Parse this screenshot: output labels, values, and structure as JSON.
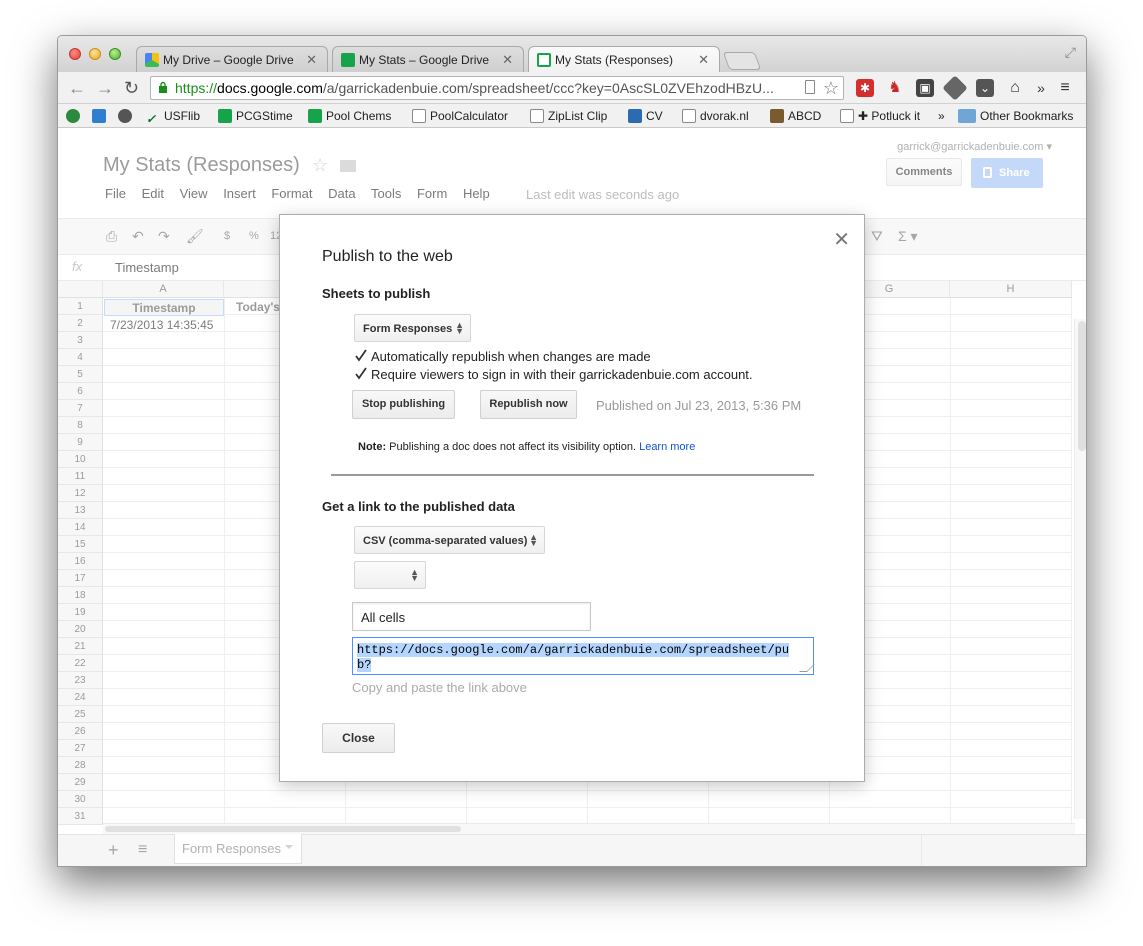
{
  "browser": {
    "tabs": [
      {
        "title": "My Drive – Google Drive"
      },
      {
        "title": "My Stats – Google Drive"
      },
      {
        "title": "My Stats (Responses)"
      }
    ],
    "url": {
      "scheme": "https://",
      "host": "docs.google.com",
      "path": "/a/garrickadenbuie.com/spreadsheet/ccc?key=0AscSL0ZVEhzodHBzU..."
    },
    "bookmarks": [
      {
        "label": "",
        "icon": "globe-icon",
        "color": "#2b8a3e"
      },
      {
        "label": "",
        "icon": "jstor-icon",
        "color": "#2f7fd1"
      },
      {
        "label": "",
        "icon": "badge-280-icon",
        "color": "#555555"
      },
      {
        "label": "USFlib",
        "icon": "usf-icon",
        "color": "#0a6b2b"
      },
      {
        "label": "PCGStime",
        "icon": "sheet-icon",
        "color": "#16a34a"
      },
      {
        "label": "Pool Chems",
        "icon": "sheet-icon",
        "color": "#16a34a"
      },
      {
        "label": "PoolCalculator",
        "icon": "page-icon",
        "color": "#ffffff"
      },
      {
        "label": "ZipList Clip",
        "icon": "page-icon",
        "color": "#ffffff"
      },
      {
        "label": "CV",
        "icon": "doc-icon",
        "color": "#2b6cb0"
      },
      {
        "label": "dvorak.nl",
        "icon": "page-icon",
        "color": "#ffffff"
      },
      {
        "label": "ABCD",
        "icon": "abcd-icon",
        "color": "#7a5b2e"
      },
      {
        "label": "✚ Potluck it",
        "icon": "page-icon",
        "color": "#ffffff"
      },
      {
        "label": "»",
        "icon": "",
        "color": ""
      },
      {
        "label": "Other Bookmarks",
        "icon": "folder-icon",
        "color": "#6fa6d6"
      }
    ]
  },
  "app": {
    "doc_title": "My Stats (Responses)",
    "menus": [
      "File",
      "Edit",
      "View",
      "Insert",
      "Format",
      "Data",
      "Tools",
      "Form",
      "Help"
    ],
    "last_edit": "Last edit was seconds ago",
    "user_email": "garrick@garrickadenbuie.com",
    "comments_label": "Comments",
    "share_label": "Share",
    "toolbar": {
      "currency": "$",
      "percent": "%",
      "format_number": "12"
    },
    "formula_bar": {
      "fx": "fx",
      "value": "Timestamp"
    },
    "columns": [
      "A",
      "",
      "",
      "",
      "",
      "",
      "G",
      "H"
    ],
    "row_count": 31,
    "cells": {
      "a1": "Timestamp",
      "b1": "Today's",
      "a2": "7/23/2013 14:35:45"
    },
    "sheet_tab": "Form Responses"
  },
  "dialog": {
    "title": "Publish to the web",
    "sheets_heading": "Sheets to publish",
    "sheets_select": "Form Responses",
    "auto_republish": {
      "label": "Automatically republish when changes are made",
      "checked": true
    },
    "require_signin": {
      "label": "Require viewers to sign in with their garrickadenbuie.com account.",
      "checked": true
    },
    "stop_publishing_label": "Stop publishing",
    "republish_label": "Republish now",
    "published_status": "Published on Jul 23, 2013, 5:36 PM",
    "note_label": "Note:",
    "note_text": "Publishing a doc does not affect its visibility option.",
    "learn_more": "Learn more",
    "link_heading": "Get a link to the published data",
    "format_select": "CSV (comma-separated values)",
    "sheet_select": "",
    "cells_input": "All cells",
    "published_url": "https://docs.google.com/a/garrickadenbuie.com/spreadsheet/pub?",
    "copy_hint": "Copy and paste the link above",
    "close_label": "Close"
  }
}
